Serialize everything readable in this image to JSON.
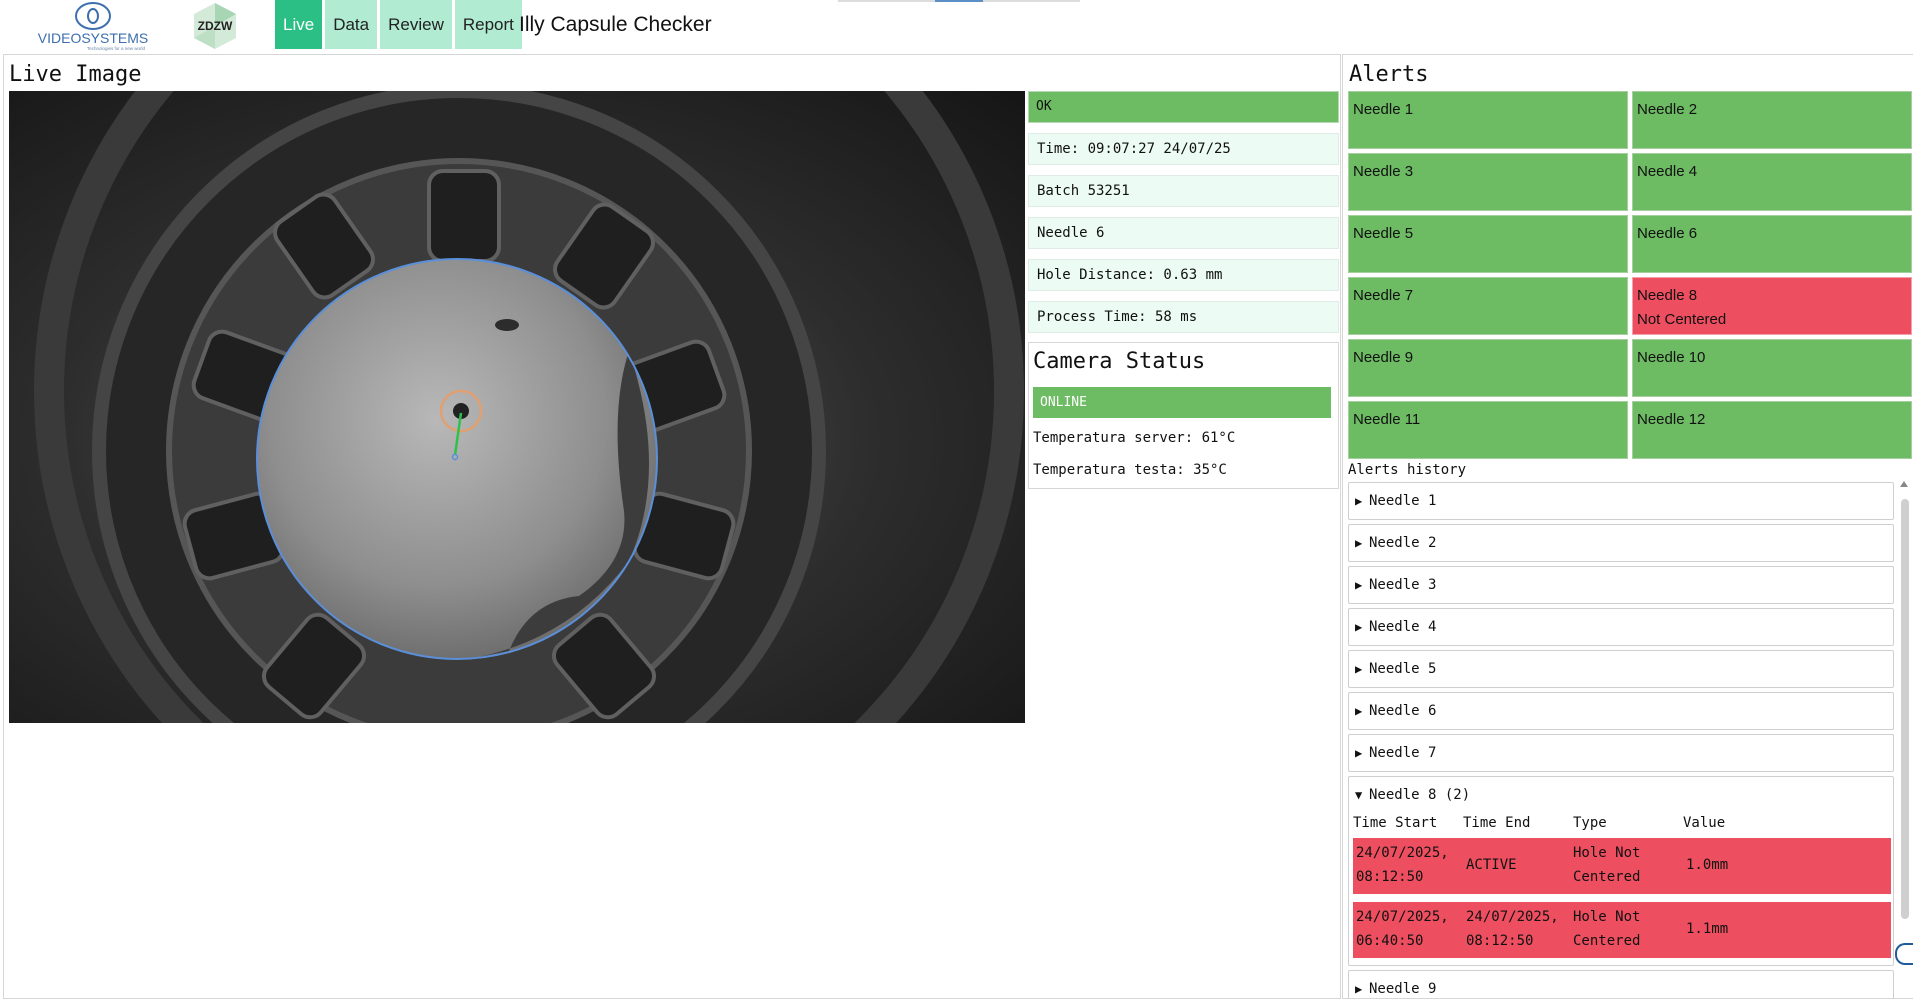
{
  "header": {
    "brand_vs": "VIDEOSYSTEMS",
    "brand_vs_tagline": "Technologies for a new world",
    "brand_zdzw": "ZDZW",
    "tabs": [
      {
        "label": "Live",
        "active": true
      },
      {
        "label": "Data",
        "active": false
      },
      {
        "label": "Review",
        "active": false
      },
      {
        "label": "Report",
        "active": false
      }
    ],
    "app_title": "Illy Capsule Checker"
  },
  "live": {
    "title": "Live Image",
    "status": "OK",
    "time": "Time: 09:07:27 24/07/25",
    "batch": "Batch 53251",
    "needle": "Needle 6",
    "hole_distance": "Hole Distance: 0.63 mm",
    "process_time": "Process Time: 58 ms",
    "camera": {
      "title": "Camera Status",
      "status": "ONLINE",
      "temp_server": "Temperatura server: 61°C",
      "temp_head": "Temperatura testa: 35°C"
    }
  },
  "alerts": {
    "title": "Alerts",
    "tiles": [
      {
        "label": "Needle 1",
        "detail": "",
        "state": "ok"
      },
      {
        "label": "Needle 2",
        "detail": "",
        "state": "ok"
      },
      {
        "label": "Needle 3",
        "detail": "",
        "state": "ok"
      },
      {
        "label": "Needle 4",
        "detail": "",
        "state": "ok"
      },
      {
        "label": "Needle 5",
        "detail": "",
        "state": "ok"
      },
      {
        "label": "Needle 6",
        "detail": "",
        "state": "ok"
      },
      {
        "label": "Needle 7",
        "detail": "",
        "state": "ok"
      },
      {
        "label": "Needle 8",
        "detail": "Not Centered",
        "state": "alert"
      },
      {
        "label": "Needle 9",
        "detail": "",
        "state": "ok"
      },
      {
        "label": "Needle 10",
        "detail": "",
        "state": "ok"
      },
      {
        "label": "Needle 11",
        "detail": "",
        "state": "ok"
      },
      {
        "label": "Needle 12",
        "detail": "",
        "state": "ok"
      }
    ],
    "history_label": "Alerts history",
    "history": [
      {
        "label": "Needle 1"
      },
      {
        "label": "Needle 2"
      },
      {
        "label": "Needle 3"
      },
      {
        "label": "Needle 4"
      },
      {
        "label": "Needle 5"
      },
      {
        "label": "Needle 6"
      },
      {
        "label": "Needle 7"
      }
    ],
    "expanded": {
      "label": "Needle 8 (2)",
      "columns": [
        "Time Start",
        "Time End",
        "Type",
        "Value"
      ],
      "rows": [
        {
          "start": [
            "24/07/2025,",
            "08:12:50"
          ],
          "end": [
            "ACTIVE",
            ""
          ],
          "type": [
            "Hole Not",
            "Centered"
          ],
          "value": "1.0mm"
        },
        {
          "start": [
            "24/07/2025,",
            "06:40:50"
          ],
          "end": [
            "24/07/2025,",
            "08:12:50"
          ],
          "type": [
            "Hole Not",
            "Centered"
          ],
          "value": "1.1mm"
        }
      ]
    },
    "after": [
      {
        "label": "Needle 9"
      }
    ]
  },
  "colors": {
    "ok_green": "#6dbb63",
    "alert_red": "#ee4f60",
    "tab_active": "#2bbf86",
    "tab_inactive": "#b0ebd2",
    "info_bg": "#ecfbf4",
    "overlay_circle": "#5b8fd9",
    "overlay_target": "#e0a070",
    "overlay_vector": "#2fc24a"
  }
}
